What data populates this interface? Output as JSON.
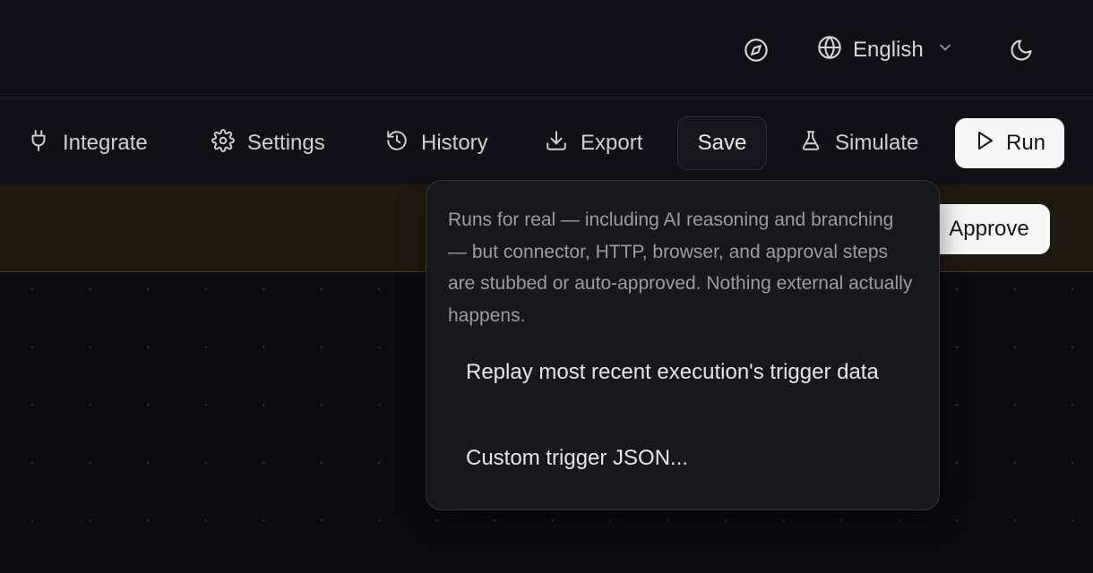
{
  "header": {
    "language": "English",
    "icons": [
      "compass-icon",
      "globe-icon",
      "chevron-down-icon",
      "moon-icon"
    ]
  },
  "toolbar": {
    "integrate": "Integrate",
    "settings": "Settings",
    "history": "History",
    "export": "Export",
    "save": "Save",
    "simulate": "Simulate",
    "run": "Run"
  },
  "banner": {
    "approve": "Approve"
  },
  "simulate_popover": {
    "description": "Runs for real — including AI reasoning and branching — but connector, HTTP, browser, and approval steps are stubbed or auto-approved. Nothing external actually happens.",
    "options": [
      "Replay most recent execution's trigger data",
      "Custom trigger JSON..."
    ]
  },
  "colors": {
    "background": "#0b0c0f",
    "banner": "#1f1a10",
    "banner_border": "#5a3d16",
    "primary_button": "#f7f7f8"
  }
}
